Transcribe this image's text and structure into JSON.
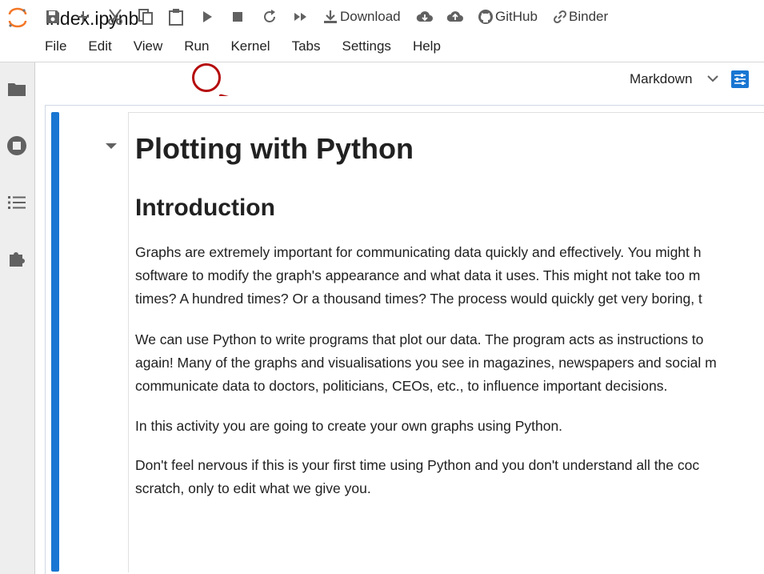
{
  "app": {
    "notebook_title": "index.ipynb",
    "menu": [
      "File",
      "Edit",
      "View",
      "Run",
      "Kernel",
      "Tabs",
      "Settings",
      "Help"
    ]
  },
  "sidebar": {
    "icons": [
      "folder-icon",
      "running-icon",
      "table-of-contents-icon",
      "extension-icon"
    ]
  },
  "toolbar": {
    "buttons": [
      "save-icon",
      "add-cell-icon",
      "cut-icon",
      "copy-icon",
      "paste-icon",
      "run-icon",
      "stop-icon",
      "restart-icon",
      "fast-forward-icon"
    ],
    "download_label": "Download",
    "github_label": "GitHub",
    "binder_label": "Binder",
    "cell_type": "Markdown",
    "accent_color": "#1976d2"
  },
  "annotation": {
    "highlight_color": "#b50c0c",
    "target": "run-button"
  },
  "cell": {
    "h1": "Plotting with Python",
    "h2": "Introduction",
    "lines": [
      "Graphs are extremely important for communicating data quickly and effectively. You might h",
      "software to modify the graph's appearance and what data it uses. This might not take too m",
      "times? A hundred times? Or a thousand times? The process would quickly get very boring, t",
      "We can use Python to write programs that plot our data. The program acts as instructions to",
      "again! Many of the graphs and visualisations you see in magazines, newspapers and social m",
      "communicate data to doctors, politicians, CEOs, etc., to influence important decisions.",
      "In this activity you are going to create your own graphs using Python.",
      "Don't feel nervous if this is your first time using Python and you don't understand all the coc",
      "scratch, only to edit what we give you."
    ]
  }
}
